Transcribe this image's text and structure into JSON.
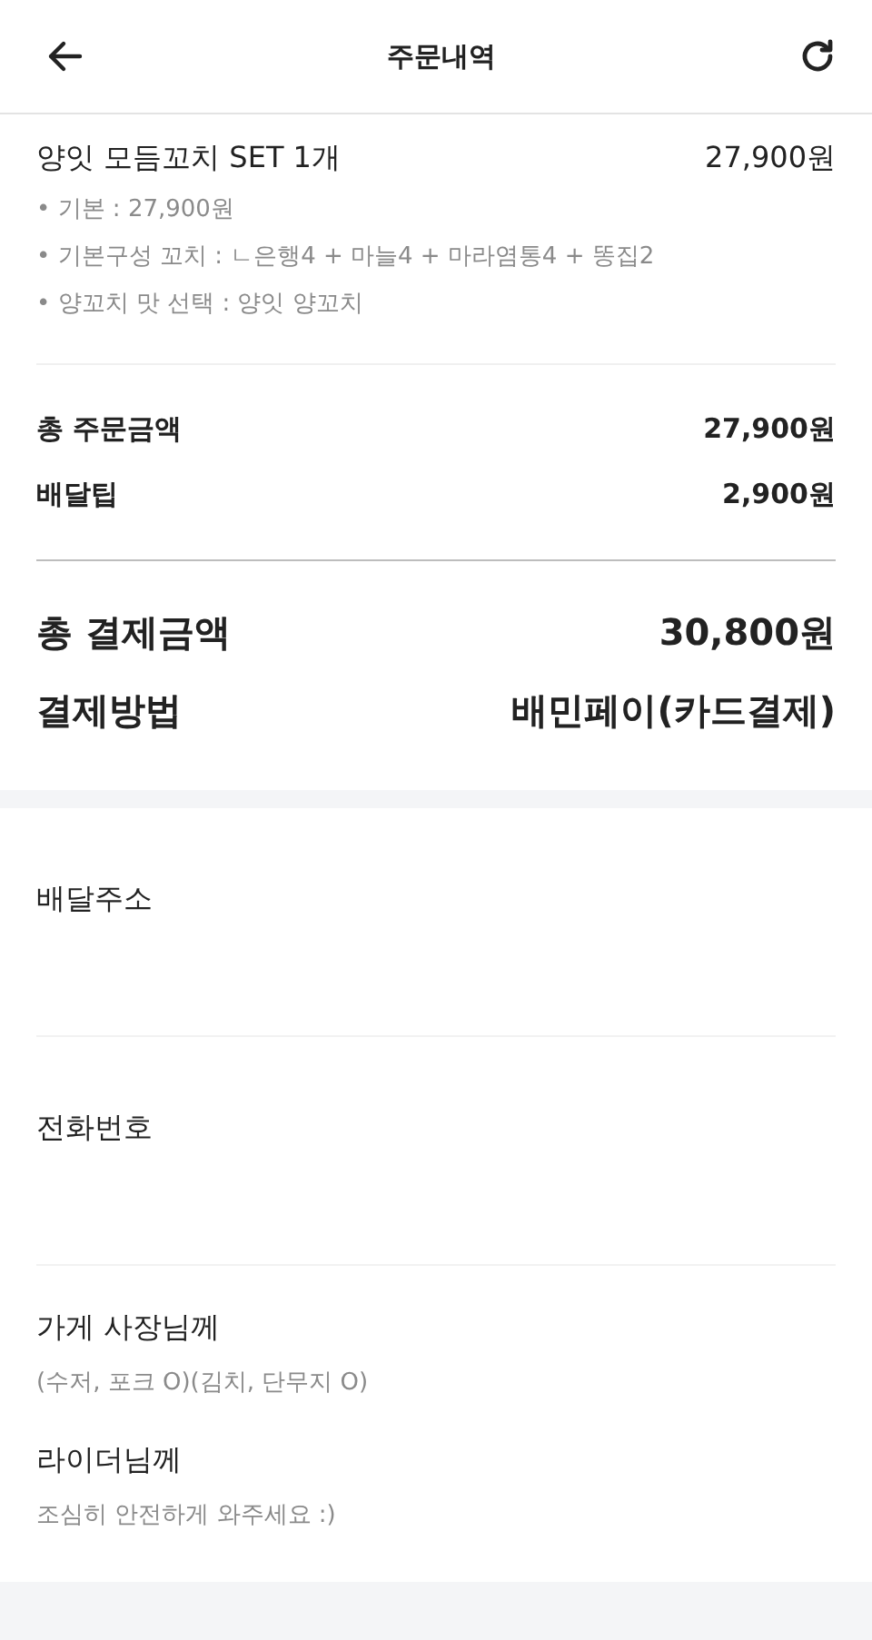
{
  "header": {
    "title": "주문내역"
  },
  "order_item": {
    "name": "양잇 모듬꼬치 SET 1개",
    "price": "27,900원",
    "options": [
      "• 기본 : 27,900원",
      "• 기본구성 꼬치 : ㄴ은행4 + 마늘4 + 마라염통4 + 똥집2",
      "• 양꼬치 맛 선택 : 양잇 양꼬치"
    ]
  },
  "summary": [
    {
      "label": "총 주문금액",
      "value": "27,900원"
    },
    {
      "label": "배달팁",
      "value": "2,900원"
    }
  ],
  "payment": [
    {
      "label": "총 결제금액",
      "value": "30,800원"
    },
    {
      "label": "결제방법",
      "value": "배민페이(카드결제)"
    }
  ],
  "info_sections": [
    {
      "label": "배달주소"
    },
    {
      "label": "전화번호"
    }
  ],
  "requests": [
    {
      "label": "가게 사장님께",
      "note": "(수저, 포크 O)(김치, 단무지 O)"
    },
    {
      "label": "라이더님께",
      "note": "조심히 안전하게 와주세요 :)"
    }
  ]
}
